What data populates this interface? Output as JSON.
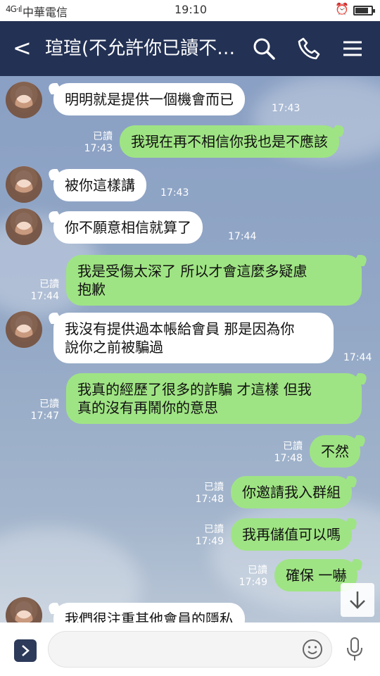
{
  "status_bar": {
    "signal": "4G·ıl",
    "carrier": "中華電信",
    "time": "19:10"
  },
  "header": {
    "back_glyph": "<",
    "title": "瑄瑄(不允許你已讀不…",
    "icons": [
      "back-icon",
      "search-icon",
      "phone-icon",
      "menu-icon"
    ]
  },
  "messages": [
    {
      "dir": "in",
      "text": "明明就是提供一個機會而已",
      "time": "17:43",
      "avatar": true
    },
    {
      "dir": "out",
      "text": "我現在再不相信你我也是不應該",
      "read": "已讀",
      "time": "17:43"
    },
    {
      "dir": "in",
      "text": "被你這樣講",
      "time": "17:43",
      "avatar": true
    },
    {
      "dir": "in",
      "text": "你不願意相信就算了",
      "time": "17:44",
      "avatar": true
    },
    {
      "dir": "out",
      "text": "我是受傷太深了 所以才會這麼多疑慮\n抱歉",
      "read": "已讀",
      "time": "17:44"
    },
    {
      "dir": "in",
      "text": "我沒有提供過本帳給會員 那是因為你\n說你之前被騙過",
      "time": "17:44",
      "avatar": true
    },
    {
      "dir": "out",
      "text": "我真的經歷了很多的詐騙 才這樣 但我\n真的沒有再鬧你的意思",
      "read": "已讀",
      "time": "17:47"
    },
    {
      "dir": "out",
      "text": "不然",
      "read": "已讀",
      "time": "17:48"
    },
    {
      "dir": "out",
      "text": "你邀請我入群組",
      "read": "已讀",
      "time": "17:48"
    },
    {
      "dir": "out",
      "text": "我再儲值可以嗎",
      "read": "已讀",
      "time": "17:49"
    },
    {
      "dir": "out",
      "text": "確保 一嚇",
      "read": "已讀",
      "time": "17:49"
    },
    {
      "dir": "in",
      "text": "我們很注重其他會員的隱私",
      "avatar": true
    }
  ],
  "input": {
    "placeholder": "",
    "icons": [
      "expand-icon",
      "emoji-icon",
      "microphone-icon"
    ]
  },
  "colors": {
    "header_bg": "#233154",
    "out_bubble": "#9fe484",
    "in_bubble": "#ffffff"
  }
}
